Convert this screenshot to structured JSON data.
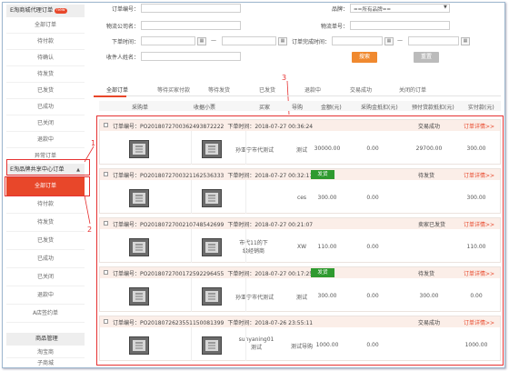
{
  "sidebar": {
    "group1": {
      "label": "E淘商城代理订单",
      "badge": "new"
    },
    "group1_items": [
      "全部订单",
      "待付款",
      "待确认",
      "待发货",
      "已发货",
      "已成功",
      "已关闭",
      "退款中",
      "异常订单"
    ],
    "group2": {
      "label": "E淘品牌共享中心订单"
    },
    "group2_items": [
      "全部订单",
      "待付款",
      "待发货",
      "已发货",
      "已成功",
      "已关闭",
      "退款中",
      "A店签约单"
    ],
    "group3": {
      "label": "商品管理"
    },
    "group3_items": [
      "淘宝商",
      "子商城",
      "商品推荐设置"
    ],
    "group3_badge": "new"
  },
  "annotations": {
    "n1": "1",
    "n2": "2",
    "n3": "3"
  },
  "form": {
    "order_no_label": "订单编号：",
    "brand_label": "品牌：",
    "brand_value": "==所有品牌==",
    "logistics_label": "物流公司名：",
    "logistics_no_label": "物流单号：",
    "order_time_label": "下单时间：",
    "complete_time_label": "订单完成时间：",
    "recipient_label": "收件人姓名：",
    "dash": "—",
    "search_btn": "搜索",
    "reset_btn": "重置"
  },
  "tabs": [
    "全部订单",
    "等待买家付款",
    "等待发货",
    "已发货",
    "退款中",
    "交易成功",
    "关闭的订单"
  ],
  "table_headers": [
    "采购单",
    "收据小票",
    "买家",
    "导购",
    "金额(元)",
    "采购金抵扣(元)",
    "预付货款抵扣(元)",
    "实付款(元)"
  ],
  "order_no_prefix": "订单编号：",
  "order_time_prefix": "下单时间：",
  "detail_link": "订单详情>>",
  "ship_label": "发货",
  "orders": [
    {
      "no": "PO2018072700362493872222",
      "time": "2018-07-27 00:36:24",
      "status": "交易成功",
      "ship": false,
      "buyer": "孙亚宁市代测试",
      "guide": "测试",
      "amount": "30000.00",
      "deduct": "0.00",
      "prepay": "29700.00",
      "paid": "300.00"
    },
    {
      "no": "PO2018072700321162536333",
      "time": "2018-07-27 00:32:11",
      "status": "待发货",
      "ship": true,
      "buyer": "",
      "guide": "ces",
      "amount": "300.00",
      "deduct": "0.00",
      "prepay": "",
      "paid": "300.00"
    },
    {
      "no": "PO2018072700210748542699",
      "time": "2018-07-27 00:21:07",
      "status": "卖家已发货",
      "ship": false,
      "buyer": "市代11的下级经销商",
      "guide": "XW",
      "amount": "110.00",
      "deduct": "0.00",
      "prepay": "",
      "paid": "110.00"
    },
    {
      "no": "PO2018072700172592296455",
      "time": "2018-07-27 00:17:25",
      "status": "待发货",
      "ship": true,
      "buyer": "孙亚宁市代测试",
      "guide": "测试",
      "amount": "300.00",
      "deduct": "0.00",
      "prepay": "300.00",
      "paid": "0.00"
    },
    {
      "no": "PO2018072623551150081399",
      "time": "2018-07-26 23:55:11",
      "status": "交易成功",
      "ship": false,
      "buyer": "sunyaning01测试",
      "guide": "测试导购",
      "amount": "1000.00",
      "deduct": "0.00",
      "prepay": "",
      "paid": "1000.00"
    }
  ]
}
